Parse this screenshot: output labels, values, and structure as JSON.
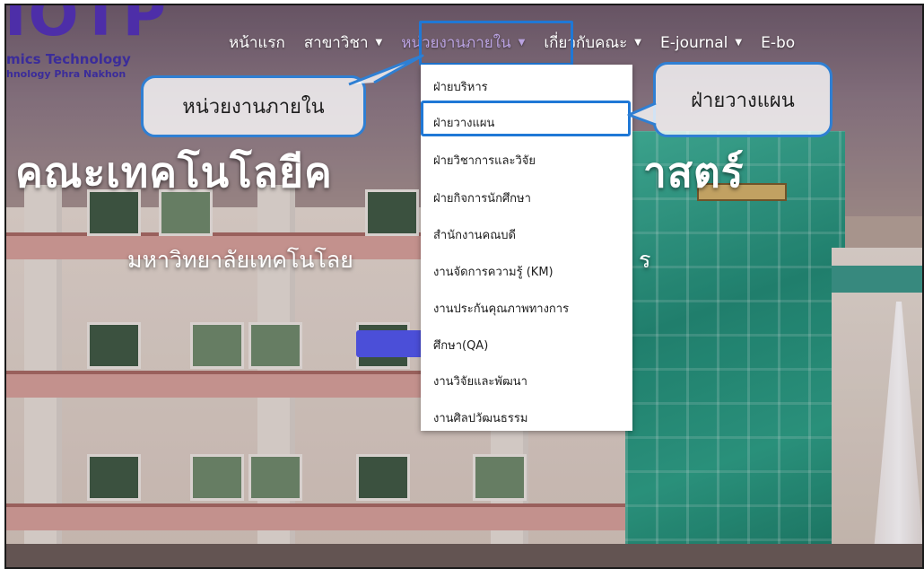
{
  "logo": {
    "mark": "IOTP",
    "line1": "mics Technology",
    "line2": "hnology Phra Nakhon"
  },
  "nav": {
    "items": [
      {
        "label": "หน้าแรก",
        "has_caret": false
      },
      {
        "label": "สาขาวิชา",
        "has_caret": true
      },
      {
        "label": "หน่วยงานภายใน",
        "has_caret": true
      },
      {
        "label": "เกี่ยวกับคณะ",
        "has_caret": true
      },
      {
        "label": "E-journal",
        "has_caret": true
      },
      {
        "label": "E-bo",
        "has_caret": false
      }
    ],
    "caret_glyph": "▼",
    "active_index": 2
  },
  "dropdown": {
    "items": [
      "ฝ่ายบริหาร",
      "ฝ่ายวางแผน",
      "ฝ่ายวิชาการและวิจัย",
      "ฝ่ายกิจการนักศึกษา",
      "สำนักงานคณบดี",
      "งานจัดการความรู้ (KM)",
      "งานประกันคุณภาพทางการ",
      "ศึกษา(QA)",
      "งานวิจัยและพัฒนา",
      "งานศิลปวัฒนธรรม"
    ],
    "highlighted_index": 1
  },
  "callouts": {
    "left": "หน่วยงานภายใน",
    "right": "ฝ่ายวางแผน"
  },
  "hero": {
    "title_start": "คณะเทคโนโลยีค",
    "title_end": "าสตร์",
    "subtitle_start": "มหาวิทยาลัยเทคโนโลย",
    "subtitle_end": "ร"
  },
  "colors": {
    "annotation_blue": "#1f78d6",
    "nav_active": "#b9a2e0",
    "logo_purple": "#4d2ea8"
  }
}
